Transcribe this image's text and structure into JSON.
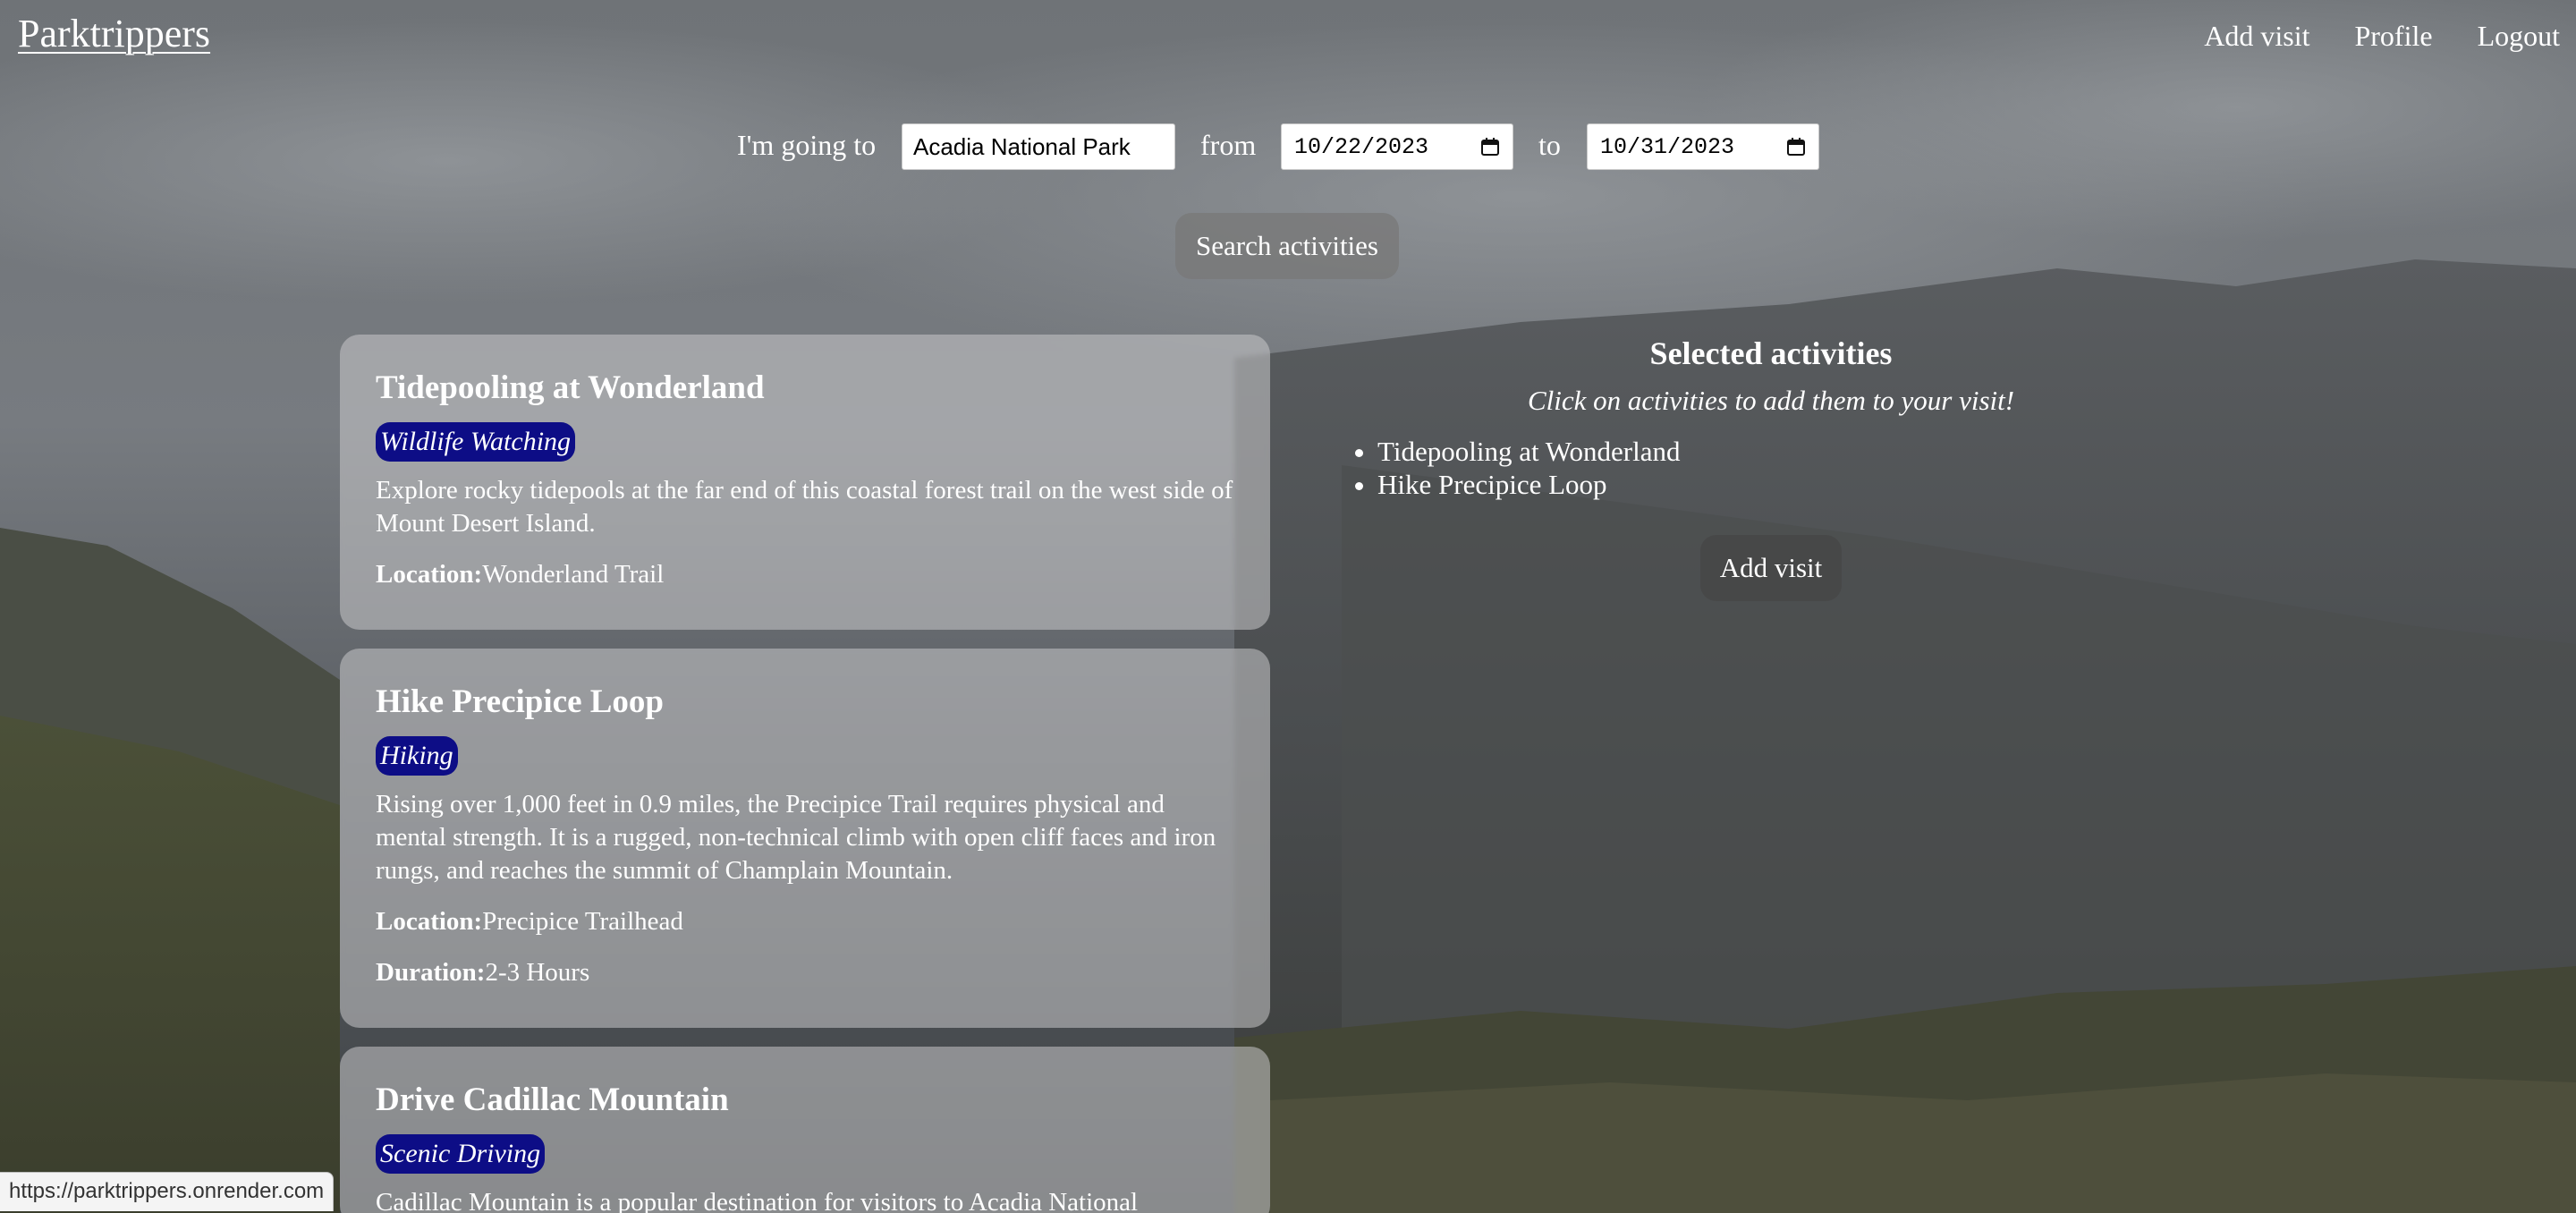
{
  "header": {
    "brand": "Parktrippers",
    "nav": {
      "add_visit": "Add visit",
      "profile": "Profile",
      "logout": "Logout"
    }
  },
  "search": {
    "going_label": "I'm going to",
    "park_value": "Acadia National Park",
    "from_label": "from",
    "from_date": "10/22/2023",
    "to_label": "to",
    "to_date": "10/31/2023",
    "button_label": "Search activities"
  },
  "activities": [
    {
      "title": "Tidepooling at Wonderland",
      "category": "Wildlife Watching",
      "description": "Explore rocky tidepools at the far end of this coastal forest trail on the west side of Mount Desert Island.",
      "location_label": "Location:",
      "location": "Wonderland Trail"
    },
    {
      "title": "Hike Precipice Loop",
      "category": "Hiking",
      "description": "Rising over 1,000 feet in 0.9 miles, the Precipice Trail requires physical and mental strength. It is a rugged, non-technical climb with open cliff faces and iron rungs, and reaches the summit of Champlain Mountain.",
      "location_label": "Location:",
      "location": "Precipice Trailhead",
      "duration_label": "Duration:",
      "duration": "2-3 Hours"
    },
    {
      "title": "Drive Cadillac Mountain",
      "category": "Scenic Driving",
      "description": "Cadillac Mountain is a popular destination for visitors to Acadia National"
    }
  ],
  "selected": {
    "heading": "Selected activities",
    "hint": "Click on activities to add them to your visit!",
    "items": [
      "Tidepooling at Wonderland",
      "Hike Precipice Loop"
    ],
    "button_label": "Add visit"
  },
  "status_url": "https://parktrippers.onrender.com",
  "colors": {
    "tag_background": "#0d0d86",
    "card_background": "rgba(200,200,203,0.55)"
  }
}
